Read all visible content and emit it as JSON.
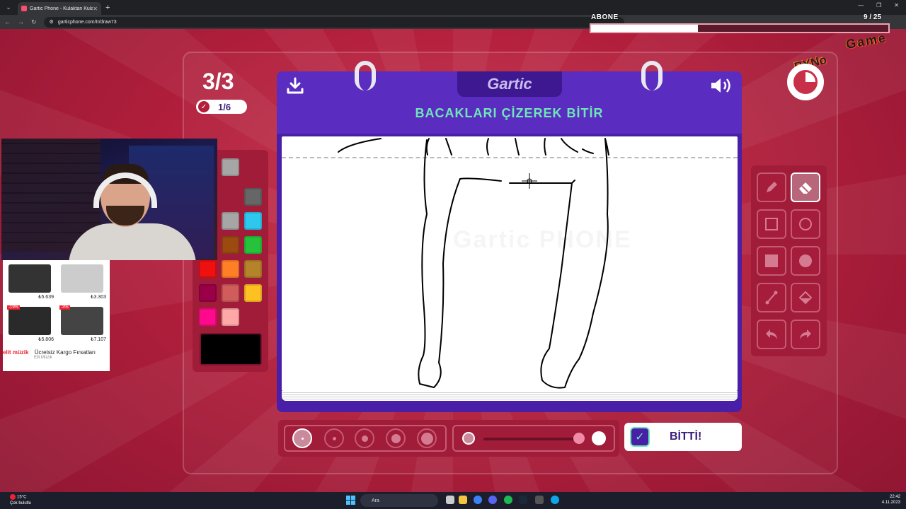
{
  "browser": {
    "tab_title": "Gartic Phone - Kulaktan Kulağa",
    "url": "garticphone.com/tr/draw73"
  },
  "overlay": {
    "sub_label": "ABONE",
    "sub_count": "9 / 25",
    "sub_progress": 0.36,
    "logo_byno": "BYNo",
    "logo_game": "Game"
  },
  "game": {
    "round": "3/3",
    "done_count": "1/6",
    "brand": "Gartic",
    "prompt": "BACAKLARI ÇİZEREK BİTİR",
    "done_button": "BİTTİ!",
    "selected_color": "#000000",
    "active_tool": "eraser",
    "brush_size_index": 0,
    "watermark": "Gartic PHONE"
  },
  "palette": {
    "colors": [
      "#a6a6a6",
      "#666666",
      "#1a56c9",
      "#a6a6a6",
      "#2ec8ef",
      "#9a0a0a",
      "#9b4a10",
      "#26c23b",
      "#ef1010",
      "#ff7f27",
      "#b5832a",
      "#990048",
      "#d05c5c",
      "#ffc024",
      "#ff0a8c",
      "#ffa8a8"
    ]
  },
  "tools": [
    "pencil",
    "eraser",
    "rectangle-outline",
    "ellipse-outline",
    "rectangle-fill",
    "ellipse-fill",
    "line",
    "fill-bucket",
    "undo",
    "redo"
  ],
  "ads": {
    "items": [
      {
        "price": "₺5.639",
        "badge": ""
      },
      {
        "price": "₺3.303",
        "badge": ""
      },
      {
        "price": "₺5.806",
        "badge": "-19%"
      },
      {
        "price": "₺7.107",
        "badge": "-3%"
      }
    ],
    "brand": "elit müzik",
    "title": "Ücretsiz Kargo Fırsatları",
    "source": "Elit Müzik"
  },
  "taskbar": {
    "weather_temp": "15°C",
    "weather_desc": "Çok bulutlu",
    "search": "Ara",
    "time": "22:42",
    "date": "4.11.2023"
  }
}
